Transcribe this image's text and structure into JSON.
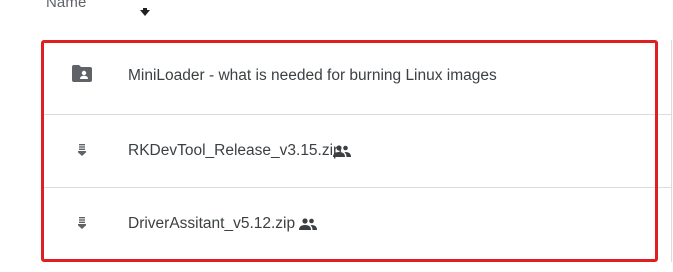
{
  "column_header": {
    "name_label": "Name",
    "sort_icon": "arrow-down-icon"
  },
  "files": [
    {
      "name": "MiniLoader - what is needed for burning Linux images",
      "type_icon": "shared-folder-icon",
      "shared": false
    },
    {
      "name": "RKDevTool_Release_v3.15.zip",
      "type_icon": "zip-file-icon",
      "shared": true,
      "shared_icon": "people-icon"
    },
    {
      "name": "DriverAssitant_v5.12.zip",
      "type_icon": "zip-file-icon",
      "shared": true,
      "shared_icon": "people-icon"
    }
  ],
  "colors": {
    "highlight": "#e02020",
    "divider": "#dadce0",
    "text": "#3c4043",
    "icon": "#5f6368"
  }
}
